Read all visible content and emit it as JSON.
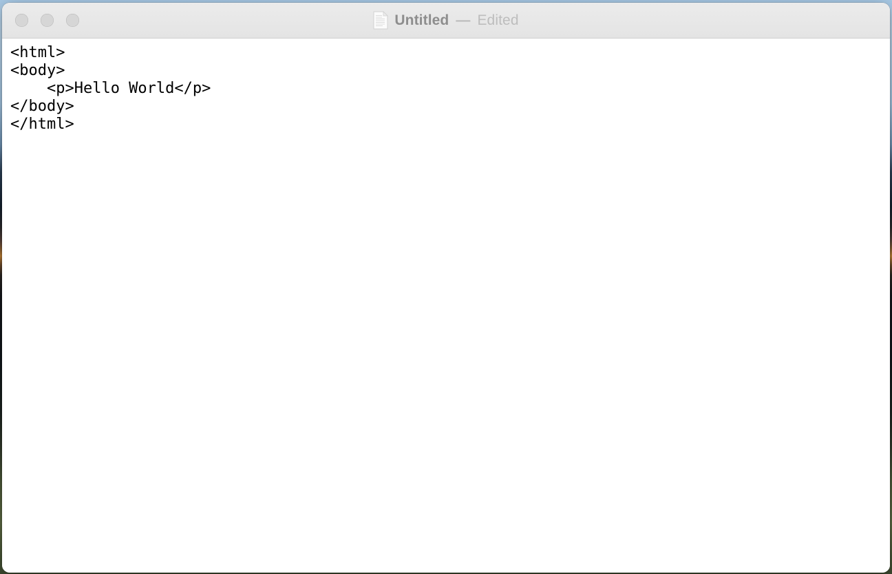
{
  "window": {
    "titlebar": {
      "document_icon": "document-icon",
      "title": "Untitled",
      "separator": "—",
      "state": "Edited",
      "traffic_lights": [
        {
          "name": "close-button",
          "label": "Close",
          "color": "#d6d6d6"
        },
        {
          "name": "minimize-button",
          "label": "Minimize",
          "color": "#d6d6d6"
        },
        {
          "name": "zoom-button",
          "label": "Zoom",
          "color": "#d6d6d6"
        }
      ]
    },
    "editor": {
      "content": "<html>\n<body>\n    <p>Hello World</p>\n</body>\n</html>",
      "lines": [
        "<html>",
        "<body>",
        "    <p>Hello World</p>",
        "</body>",
        "</html>"
      ],
      "text_color": "#000000",
      "background_color": "#ffffff"
    }
  },
  "desktop": {
    "wallpaper_colors": [
      "#b9d4ea",
      "#2b3f55",
      "#c08135",
      "#14161a",
      "#5e6b44"
    ]
  }
}
